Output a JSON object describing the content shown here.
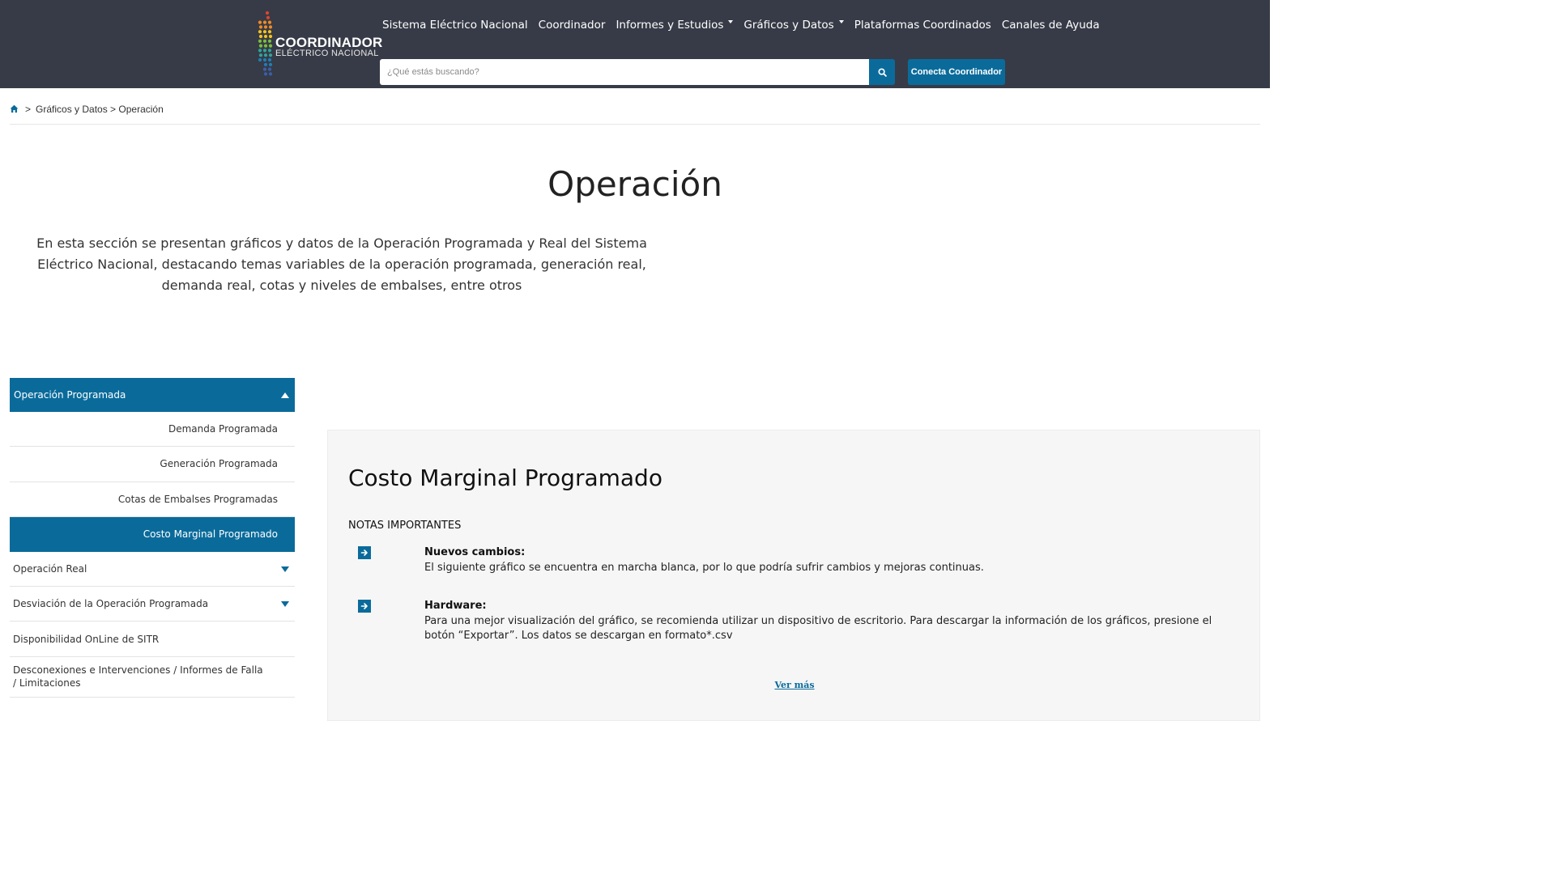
{
  "brand": {
    "name": "COORDINADOR",
    "subtitle": "ELÉCTRICO NACIONAL",
    "dot_colors": [
      "#e0452b",
      "#f08a24",
      "#f6c21c",
      "#7bbf3c",
      "#2fa59a",
      "#1f7fb6",
      "#3a5fa8"
    ]
  },
  "nav": {
    "items": [
      {
        "label": "Sistema Eléctrico Nacional",
        "dropdown": false
      },
      {
        "label": "Coordinador",
        "dropdown": false
      },
      {
        "label": "Informes y Estudios",
        "dropdown": true
      },
      {
        "label": "Gráficos y Datos",
        "dropdown": true
      },
      {
        "label": "Plataformas Coordinados",
        "dropdown": false
      },
      {
        "label": "Canales de Ayuda",
        "dropdown": false
      }
    ]
  },
  "search": {
    "placeholder": "¿Qué estás buscando?",
    "value": ""
  },
  "connect_button": "Conecta Coordinador",
  "breadcrumb": {
    "separator": ">",
    "trail": "Gráficos y Datos > Operación"
  },
  "page": {
    "title": "Operación",
    "intro": "En esta sección se presentan gráficos y datos de la Operación Programada y Real del Sistema Eléctrico Nacional, destacando temas variables de la operación programada, generación real, demanda real, cotas y niveles de embalses, entre otros"
  },
  "sidebar": {
    "section": "Operación Programada",
    "sub_items": [
      {
        "label": "Demanda Programada",
        "active": false
      },
      {
        "label": "Generación Programada",
        "active": false
      },
      {
        "label": "Cotas de Embalses Programadas",
        "active": false
      },
      {
        "label": "Costo Marginal Programado",
        "active": true
      }
    ],
    "main_items": [
      {
        "label": "Operación Real",
        "expandable": true
      },
      {
        "label": "Desviación de la Operación Programada",
        "expandable": true
      },
      {
        "label": "Disponibilidad OnLine de SITR",
        "expandable": false
      },
      {
        "label": "Desconexiones e Intervenciones / Informes de Falla / Limitaciones",
        "expandable": false
      }
    ]
  },
  "content": {
    "title": "Costo Marginal Programado",
    "notes_heading": "NOTAS IMPORTANTES",
    "notes": [
      {
        "title": "Nuevos cambios:",
        "text": "El siguiente gráfico se encuentra en marcha blanca, por lo que podría sufrir cambios y mejoras continuas."
      },
      {
        "title": "Hardware:",
        "text": "Para una mejor visualización del gráfico, se recomienda utilizar un dispositivo de escritorio. Para descargar la información de los gráficos, presione el botón “Exportar”. Los datos se descargan en formato*.csv"
      }
    ],
    "more_link": "Ver más"
  },
  "colors": {
    "header_bg": "#373b47",
    "accent": "#0a6b9b",
    "panel_bg": "#f6f6f6"
  }
}
